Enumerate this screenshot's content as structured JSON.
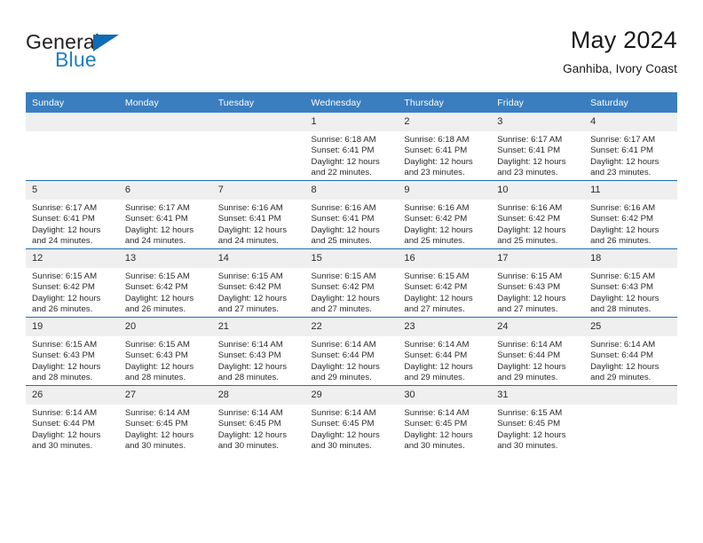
{
  "brand": {
    "word_general": "General",
    "word_blue": "Blue",
    "flag_icon": "brand-triangle-icon",
    "accent_color": "#0f6cb5"
  },
  "header": {
    "title": "May 2024",
    "subtitle": "Ganhiba, Ivory Coast"
  },
  "calendar": {
    "header_bg": "#3a7ebf",
    "row_rule_color": "#1f6eb5",
    "daynum_bg": "#efefef",
    "weekday_headers": [
      "Sunday",
      "Monday",
      "Tuesday",
      "Wednesday",
      "Thursday",
      "Friday",
      "Saturday"
    ],
    "weeks": [
      [
        {
          "day": "",
          "lines": []
        },
        {
          "day": "",
          "lines": []
        },
        {
          "day": "",
          "lines": []
        },
        {
          "day": "1",
          "lines": [
            "Sunrise: 6:18 AM",
            "Sunset: 6:41 PM",
            "Daylight: 12 hours",
            "and 22 minutes."
          ]
        },
        {
          "day": "2",
          "lines": [
            "Sunrise: 6:18 AM",
            "Sunset: 6:41 PM",
            "Daylight: 12 hours",
            "and 23 minutes."
          ]
        },
        {
          "day": "3",
          "lines": [
            "Sunrise: 6:17 AM",
            "Sunset: 6:41 PM",
            "Daylight: 12 hours",
            "and 23 minutes."
          ]
        },
        {
          "day": "4",
          "lines": [
            "Sunrise: 6:17 AM",
            "Sunset: 6:41 PM",
            "Daylight: 12 hours",
            "and 23 minutes."
          ]
        }
      ],
      [
        {
          "day": "5",
          "lines": [
            "Sunrise: 6:17 AM",
            "Sunset: 6:41 PM",
            "Daylight: 12 hours",
            "and 24 minutes."
          ]
        },
        {
          "day": "6",
          "lines": [
            "Sunrise: 6:17 AM",
            "Sunset: 6:41 PM",
            "Daylight: 12 hours",
            "and 24 minutes."
          ]
        },
        {
          "day": "7",
          "lines": [
            "Sunrise: 6:16 AM",
            "Sunset: 6:41 PM",
            "Daylight: 12 hours",
            "and 24 minutes."
          ]
        },
        {
          "day": "8",
          "lines": [
            "Sunrise: 6:16 AM",
            "Sunset: 6:41 PM",
            "Daylight: 12 hours",
            "and 25 minutes."
          ]
        },
        {
          "day": "9",
          "lines": [
            "Sunrise: 6:16 AM",
            "Sunset: 6:42 PM",
            "Daylight: 12 hours",
            "and 25 minutes."
          ]
        },
        {
          "day": "10",
          "lines": [
            "Sunrise: 6:16 AM",
            "Sunset: 6:42 PM",
            "Daylight: 12 hours",
            "and 25 minutes."
          ]
        },
        {
          "day": "11",
          "lines": [
            "Sunrise: 6:16 AM",
            "Sunset: 6:42 PM",
            "Daylight: 12 hours",
            "and 26 minutes."
          ]
        }
      ],
      [
        {
          "day": "12",
          "lines": [
            "Sunrise: 6:15 AM",
            "Sunset: 6:42 PM",
            "Daylight: 12 hours",
            "and 26 minutes."
          ]
        },
        {
          "day": "13",
          "lines": [
            "Sunrise: 6:15 AM",
            "Sunset: 6:42 PM",
            "Daylight: 12 hours",
            "and 26 minutes."
          ]
        },
        {
          "day": "14",
          "lines": [
            "Sunrise: 6:15 AM",
            "Sunset: 6:42 PM",
            "Daylight: 12 hours",
            "and 27 minutes."
          ]
        },
        {
          "day": "15",
          "lines": [
            "Sunrise: 6:15 AM",
            "Sunset: 6:42 PM",
            "Daylight: 12 hours",
            "and 27 minutes."
          ]
        },
        {
          "day": "16",
          "lines": [
            "Sunrise: 6:15 AM",
            "Sunset: 6:42 PM",
            "Daylight: 12 hours",
            "and 27 minutes."
          ]
        },
        {
          "day": "17",
          "lines": [
            "Sunrise: 6:15 AM",
            "Sunset: 6:43 PM",
            "Daylight: 12 hours",
            "and 27 minutes."
          ]
        },
        {
          "day": "18",
          "lines": [
            "Sunrise: 6:15 AM",
            "Sunset: 6:43 PM",
            "Daylight: 12 hours",
            "and 28 minutes."
          ]
        }
      ],
      [
        {
          "day": "19",
          "lines": [
            "Sunrise: 6:15 AM",
            "Sunset: 6:43 PM",
            "Daylight: 12 hours",
            "and 28 minutes."
          ]
        },
        {
          "day": "20",
          "lines": [
            "Sunrise: 6:15 AM",
            "Sunset: 6:43 PM",
            "Daylight: 12 hours",
            "and 28 minutes."
          ]
        },
        {
          "day": "21",
          "lines": [
            "Sunrise: 6:14 AM",
            "Sunset: 6:43 PM",
            "Daylight: 12 hours",
            "and 28 minutes."
          ]
        },
        {
          "day": "22",
          "lines": [
            "Sunrise: 6:14 AM",
            "Sunset: 6:44 PM",
            "Daylight: 12 hours",
            "and 29 minutes."
          ]
        },
        {
          "day": "23",
          "lines": [
            "Sunrise: 6:14 AM",
            "Sunset: 6:44 PM",
            "Daylight: 12 hours",
            "and 29 minutes."
          ]
        },
        {
          "day": "24",
          "lines": [
            "Sunrise: 6:14 AM",
            "Sunset: 6:44 PM",
            "Daylight: 12 hours",
            "and 29 minutes."
          ]
        },
        {
          "day": "25",
          "lines": [
            "Sunrise: 6:14 AM",
            "Sunset: 6:44 PM",
            "Daylight: 12 hours",
            "and 29 minutes."
          ]
        }
      ],
      [
        {
          "day": "26",
          "lines": [
            "Sunrise: 6:14 AM",
            "Sunset: 6:44 PM",
            "Daylight: 12 hours",
            "and 30 minutes."
          ]
        },
        {
          "day": "27",
          "lines": [
            "Sunrise: 6:14 AM",
            "Sunset: 6:45 PM",
            "Daylight: 12 hours",
            "and 30 minutes."
          ]
        },
        {
          "day": "28",
          "lines": [
            "Sunrise: 6:14 AM",
            "Sunset: 6:45 PM",
            "Daylight: 12 hours",
            "and 30 minutes."
          ]
        },
        {
          "day": "29",
          "lines": [
            "Sunrise: 6:14 AM",
            "Sunset: 6:45 PM",
            "Daylight: 12 hours",
            "and 30 minutes."
          ]
        },
        {
          "day": "30",
          "lines": [
            "Sunrise: 6:14 AM",
            "Sunset: 6:45 PM",
            "Daylight: 12 hours",
            "and 30 minutes."
          ]
        },
        {
          "day": "31",
          "lines": [
            "Sunrise: 6:15 AM",
            "Sunset: 6:45 PM",
            "Daylight: 12 hours",
            "and 30 minutes."
          ]
        },
        {
          "day": "",
          "lines": []
        }
      ]
    ]
  }
}
